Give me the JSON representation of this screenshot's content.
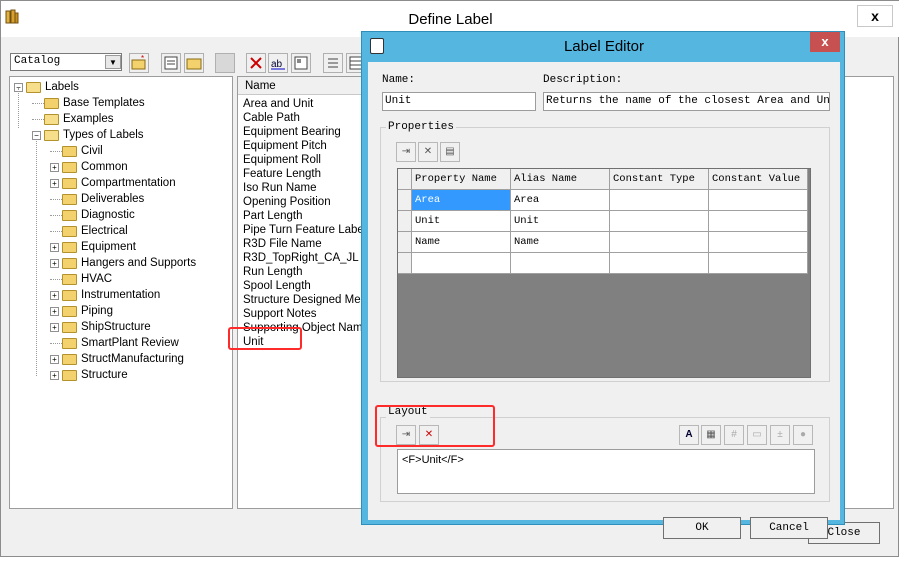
{
  "main_window": {
    "title": "Define Label",
    "close_glyph": "x",
    "catalog_value": "Catalog",
    "close_button": "Close"
  },
  "tree": {
    "root": "Labels",
    "items": [
      {
        "label": "Base Templates",
        "level": 1,
        "expander": false
      },
      {
        "label": "Examples",
        "level": 1,
        "expander": false
      },
      {
        "label": "Types of Labels",
        "level": 1,
        "expander": true
      },
      {
        "label": "Civil",
        "level": 2,
        "expander": false
      },
      {
        "label": "Common",
        "level": 2,
        "expander": true
      },
      {
        "label": "Compartmentation",
        "level": 2,
        "expander": true
      },
      {
        "label": "Deliverables",
        "level": 2,
        "expander": false
      },
      {
        "label": "Diagnostic",
        "level": 2,
        "expander": false
      },
      {
        "label": "Electrical",
        "level": 2,
        "expander": false
      },
      {
        "label": "Equipment",
        "level": 2,
        "expander": true
      },
      {
        "label": "Hangers and Supports",
        "level": 2,
        "expander": true
      },
      {
        "label": "HVAC",
        "level": 2,
        "expander": false
      },
      {
        "label": "Instrumentation",
        "level": 2,
        "expander": true
      },
      {
        "label": "Piping",
        "level": 2,
        "expander": true
      },
      {
        "label": "ShipStructure",
        "level": 2,
        "expander": true
      },
      {
        "label": "SmartPlant Review",
        "level": 2,
        "expander": false
      },
      {
        "label": "StructManufacturing",
        "level": 2,
        "expander": true
      },
      {
        "label": "Structure",
        "level": 2,
        "expander": true
      }
    ]
  },
  "list": {
    "header": "Name",
    "items": [
      "Area and Unit",
      "Cable Path",
      "Equipment Bearing",
      "Equipment Pitch",
      "Equipment Roll",
      "Feature Length",
      "Iso Run Name",
      "Opening Position",
      "Part Length",
      "Pipe Turn Feature Label",
      "R3D File Name",
      "R3D_TopRight_CA_JL",
      "Run Length",
      "Spool Length",
      "Structure Designed Memb",
      "Support Notes",
      "Supporting Object Name",
      "Unit"
    ]
  },
  "editor": {
    "title": "Label Editor",
    "close_glyph": "x",
    "name_label": "Name:",
    "name_value": "Unit",
    "description_label": "Description:",
    "description_value": "Returns the name of the closest Area and Unit s",
    "properties_label": "Properties",
    "columns": [
      "Property Name",
      "Alias Name",
      "Constant Type",
      "Constant Value"
    ],
    "rows": [
      [
        "Area",
        "Area",
        "",
        ""
      ],
      [
        "Unit",
        "Unit",
        "",
        ""
      ],
      [
        "Name",
        "Name",
        "",
        ""
      ],
      [
        "",
        "",
        "",
        ""
      ]
    ],
    "layout_label": "Layout",
    "layout_text": "<F>Unit</F>",
    "ok": "OK",
    "cancel": "Cancel"
  },
  "colors": {
    "dialog_frame": "#55b7e0",
    "close_red": "#c75050",
    "selection": "#3399ff",
    "highlight": "#ff2a2a"
  }
}
